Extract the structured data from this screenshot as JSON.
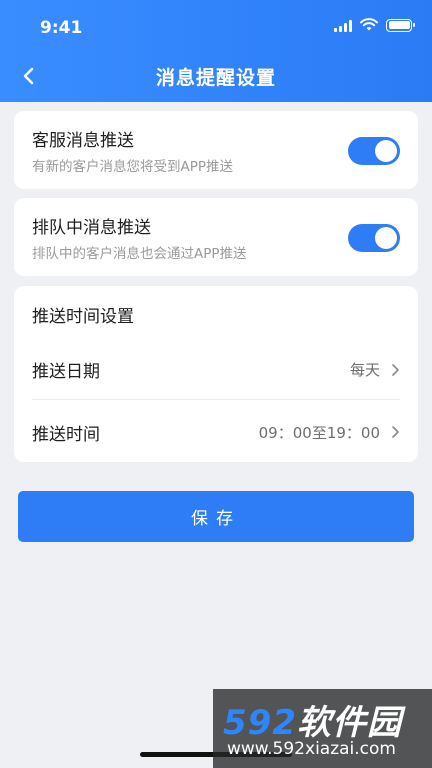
{
  "status_bar": {
    "time": "9:41"
  },
  "nav": {
    "title": "消息提醒设置",
    "back_icon": "chevron-left-icon"
  },
  "settings": [
    {
      "title": "客服消息推送",
      "subtitle": "有新的客户消息您将受到APP推送",
      "enabled": true
    },
    {
      "title": "排队中消息推送",
      "subtitle": "排队中的客户消息也会通过APP推送",
      "enabled": true
    }
  ],
  "push_time": {
    "section_title": "推送时间设置",
    "rows": [
      {
        "label": "推送日期",
        "value": "每天"
      },
      {
        "label": "推送时间",
        "value": "09：00至19：00"
      }
    ]
  },
  "save_label": "保存",
  "watermark": {
    "logo_number": "592",
    "logo_text": "软件园",
    "url": "www.592xiazai.com"
  },
  "colors": {
    "primary": "#2f7df6",
    "background": "#eef0f4",
    "card": "#ffffff"
  }
}
